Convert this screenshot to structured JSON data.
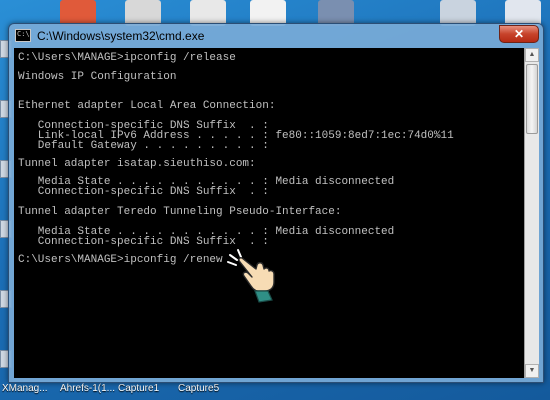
{
  "window": {
    "title": "C:\\Windows\\system32\\cmd.exe",
    "close_symbol": "✕",
    "icon_text": "C:\\"
  },
  "console": {
    "lines": [
      "C:\\Users\\MANAGE>ipconfig /release",
      "",
      "Windows IP Configuration",
      "",
      "",
      "Ethernet adapter Local Area Connection:",
      "",
      "   Connection-specific DNS Suffix  . :",
      "   Link-local IPv6 Address . . . . . : fe80::1059:8ed7:1ec:74d0%11",
      "   Default Gateway . . . . . . . . . :",
      "",
      "Tunnel adapter isatap.sieuthiso.com:",
      "",
      "   Media State . . . . . . . . . . . : Media disconnected",
      "   Connection-specific DNS Suffix  . :",
      "",
      "Tunnel adapter Teredo Tunneling Pseudo-Interface:",
      "",
      "   Media State . . . . . . . . . . . : Media disconnected",
      "   Connection-specific DNS Suffix  . :",
      "",
      "C:\\Users\\MANAGE>ipconfig /renew"
    ]
  },
  "taskbar_labels": [
    "XManag...",
    "Ahrefs-1(1...",
    "Capture1",
    "Capture5"
  ],
  "colors": {
    "console_bg": "#000000",
    "console_text": "#c0c0c0",
    "hand_fill": "#f7dcb4",
    "cuff_fill": "#2f8f86",
    "desktop": "#1c6fb7"
  },
  "icons": [
    "cmd-icon",
    "close-icon",
    "pointing-hand-icon"
  ]
}
